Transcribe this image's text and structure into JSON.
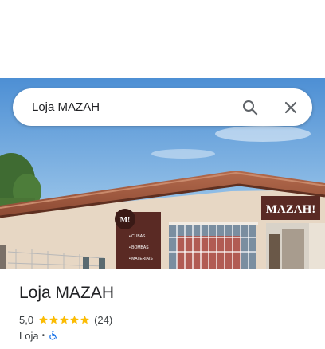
{
  "search": {
    "query": "Loja MAZAH"
  },
  "hero": {
    "sign_text": "MAZAH!",
    "panel_logo": "M!",
    "panel_items": [
      "• CUBAS",
      "• BOMBAS",
      "• MATERIAIS"
    ]
  },
  "place": {
    "title": "Loja MAZAH",
    "rating": "5,0",
    "stars": 5,
    "review_count": "(24)",
    "category": "Loja",
    "separator": "•",
    "wheelchair_accessible_icon": "wheelchair-icon"
  },
  "colors": {
    "star": "#fbbc04",
    "accessibility": "#1a73e8",
    "text_primary": "#202124",
    "text_secondary": "#3c4043"
  }
}
